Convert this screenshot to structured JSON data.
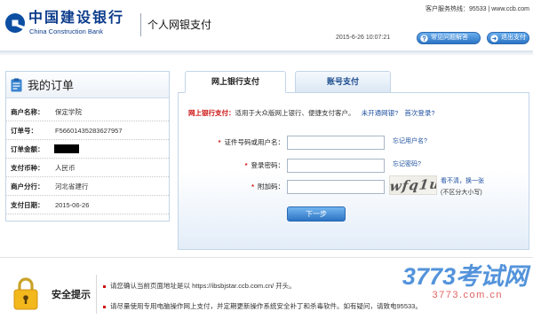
{
  "colors": {
    "brand_blue": "#0d3c8c",
    "link_blue": "#1d4f9f",
    "alert_red": "#cc1111",
    "button_blue": "#2c74c4",
    "panel_border": "#c3d5e8"
  },
  "icons": {
    "logo": "ccb-logo-icon",
    "faq": "question-circle-icon",
    "exit": "exit-icon",
    "order": "order-document-icon",
    "security": "lock-icon"
  },
  "header": {
    "bank_name_cn": "中国建设银行",
    "bank_name_en": "China Construction Bank",
    "service_title": "个人网银支付",
    "hotline": "客户服务热线：95533 | www.ccb.com",
    "datetime": "2015-6-26 10:07:21",
    "faq_label": "常见问题解答",
    "exit_label": "退出支付"
  },
  "order": {
    "title": "我的订单",
    "rows": [
      {
        "label": "商户名称：",
        "value": "保定学院"
      },
      {
        "label": "订单号：",
        "value": "F56601435283627957"
      },
      {
        "label": "订单金额：",
        "redacted": true
      },
      {
        "label": "支付币种：",
        "value": "人民币"
      },
      {
        "label": "商户分行：",
        "value": "河北省建行"
      },
      {
        "label": "支付日期：",
        "value": "2015-06-26"
      }
    ]
  },
  "payment": {
    "tabs": [
      {
        "label": "网上银行支付",
        "active": true
      },
      {
        "label": "账号支付",
        "active": false
      }
    ],
    "intro": {
      "label": "网上银行支付：",
      "text": "适用于大众版网上银行、便捷支付客户。",
      "not_enabled_link": "未开通网银?",
      "first_login_link": "首次登录?"
    },
    "form": {
      "required_mark": "*",
      "username": {
        "label": "证件号码或用户名：",
        "value": "",
        "help_link": "忘记用户名?"
      },
      "password": {
        "label": "登录密码：",
        "value": "",
        "help_link": "忘记密码?"
      },
      "captcha": {
        "label": "附加码：",
        "value": "",
        "image_text": "wfq1u",
        "refresh_link": "看不清，换一张",
        "case_note": "(不区分大小写)"
      },
      "submit_label": "下一步"
    }
  },
  "security": {
    "title": "安全提示",
    "tips": [
      "请您确认当前页面地址是以 https://ibsbjstar.ccb.com.cn/ 开头。",
      "请尽量使用专用电脑操作网上支付，并定期更新操作系统安全补丁和杀毒软件。如有疑问，请致电95533。"
    ]
  },
  "watermark": {
    "main": "3773考试网",
    "sub": "3773.com.cn"
  }
}
